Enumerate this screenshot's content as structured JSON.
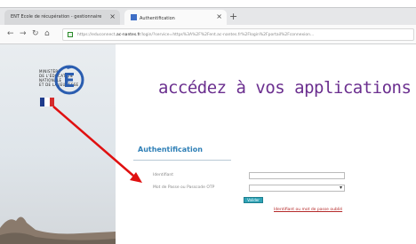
{
  "browser": {
    "tabs": [
      {
        "label": "ENT Ecole de récupération - gestionnaire",
        "active": false
      },
      {
        "label": "Authentification",
        "active": true
      }
    ],
    "new_tab_label": "+",
    "address": {
      "url_prefix": "https://educonnect",
      "url_domain": ".ac-nantes.fr",
      "url_rest": "/login/?service=https%3A%2F%2Fent.ac-nantes.fr%2Flogin%2Fportail%2Fconnexion..."
    }
  },
  "page": {
    "logo_text": [
      "MINISTÈRE",
      "DE L'ÉDUCATION",
      "NATIONALE",
      "ET DE LA JEUNESSE"
    ],
    "headline": "accédez à vos applications",
    "auth": {
      "title": "Authentification",
      "identifier_label": "Identifiant",
      "password_label": "Mot de Passe ou Passcode OTP",
      "submit_label": "Valider",
      "forgot_link": "Identifiant ou mot de passe oublié"
    }
  },
  "colors": {
    "headline": "#6b2f8f",
    "auth_title": "#2e7fb6",
    "arrow": "#e01010"
  }
}
